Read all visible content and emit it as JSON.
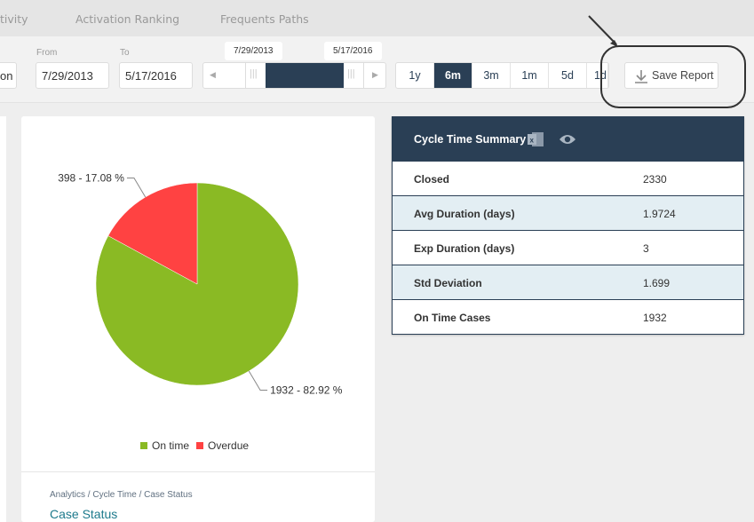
{
  "nav": {
    "tabs": [
      "tivity",
      "Activation Ranking",
      "Frequents Paths"
    ]
  },
  "toolbar": {
    "left_button": "on",
    "from_label": "From",
    "from_value": "7/29/2013",
    "to_label": "To",
    "to_value": "5/17/2016",
    "slider": {
      "start": "7/29/2013",
      "end": "5/17/2016"
    },
    "ranges": [
      {
        "label": "1y"
      },
      {
        "label": "6m",
        "active": true
      },
      {
        "label": "3m"
      },
      {
        "label": "1m"
      },
      {
        "label": "5d"
      },
      {
        "label": "1d"
      }
    ],
    "save_label": "Save Report",
    "save_icon": "download-icon"
  },
  "chart_data": {
    "type": "pie",
    "categories": [
      "On time",
      "Overdue"
    ],
    "values": [
      1932,
      398
    ],
    "percents": [
      82.92,
      17.08
    ],
    "labels": [
      "1932 - 82.92 %",
      "398 - 17.08 %"
    ],
    "colors": [
      "#8aba24",
      "#ff4242"
    ],
    "legend": "bottom"
  },
  "breadcrumb": "Analytics / Cycle Time / Case Status",
  "section_title": "Case Status",
  "summary": {
    "title": "Cycle Time Summary",
    "icons": [
      "excel-icon",
      "eye-icon"
    ],
    "rows": [
      {
        "label": "Closed",
        "value": "2330"
      },
      {
        "label": "Avg Duration (days)",
        "value": "1.9724"
      },
      {
        "label": "Exp Duration (days)",
        "value": "3"
      },
      {
        "label": "Std Deviation",
        "value": "1.699"
      },
      {
        "label": "On Time Cases",
        "value": "1932"
      }
    ]
  },
  "colors": {
    "accent": "#2a3f55"
  }
}
